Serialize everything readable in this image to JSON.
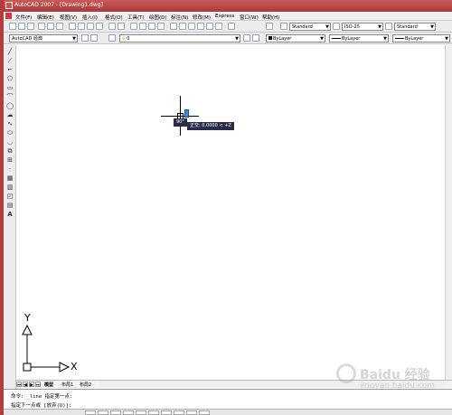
{
  "window": {
    "title": "AutoCAD 2007 - [Drawing1.dwg]"
  },
  "menubar": {
    "items": [
      "文件(F)",
      "编辑(E)",
      "视图(V)",
      "插入(I)",
      "格式(O)",
      "工具(T)",
      "绘图(D)",
      "标注(N)",
      "修改(M)",
      "Express",
      "窗口(W)",
      "帮助(H)"
    ]
  },
  "toolbar_styles": {
    "text_style": "Standard",
    "dim_style": "ISO-25",
    "table_style": "Standard"
  },
  "toolbar_layers": {
    "workspace": "AutoCAD 经典",
    "layer": "0",
    "color": "ByLayer",
    "linetype": "ByLayer",
    "lineweight": "ByLayer"
  },
  "drawing": {
    "tooltip_angle": "90°",
    "tooltip_polar": "正交: 0.0000 < +Z"
  },
  "ucs": {
    "y_label": "Y",
    "x_label": "X"
  },
  "tabs": {
    "model": "模型",
    "layout1": "布局1",
    "layout2": "布局2"
  },
  "command": {
    "history": "命令: _line 指定第一点:",
    "prompt": "指定下一点或 [放弃(U)]:"
  },
  "watermark": {
    "text": "Baidu 经验",
    "url": "jingyan.baidu.com"
  },
  "colors": {
    "title_bar": "#b43c3c",
    "tooltip_bg": "#2a2a4a",
    "snap_marker": "#3e88d8"
  }
}
